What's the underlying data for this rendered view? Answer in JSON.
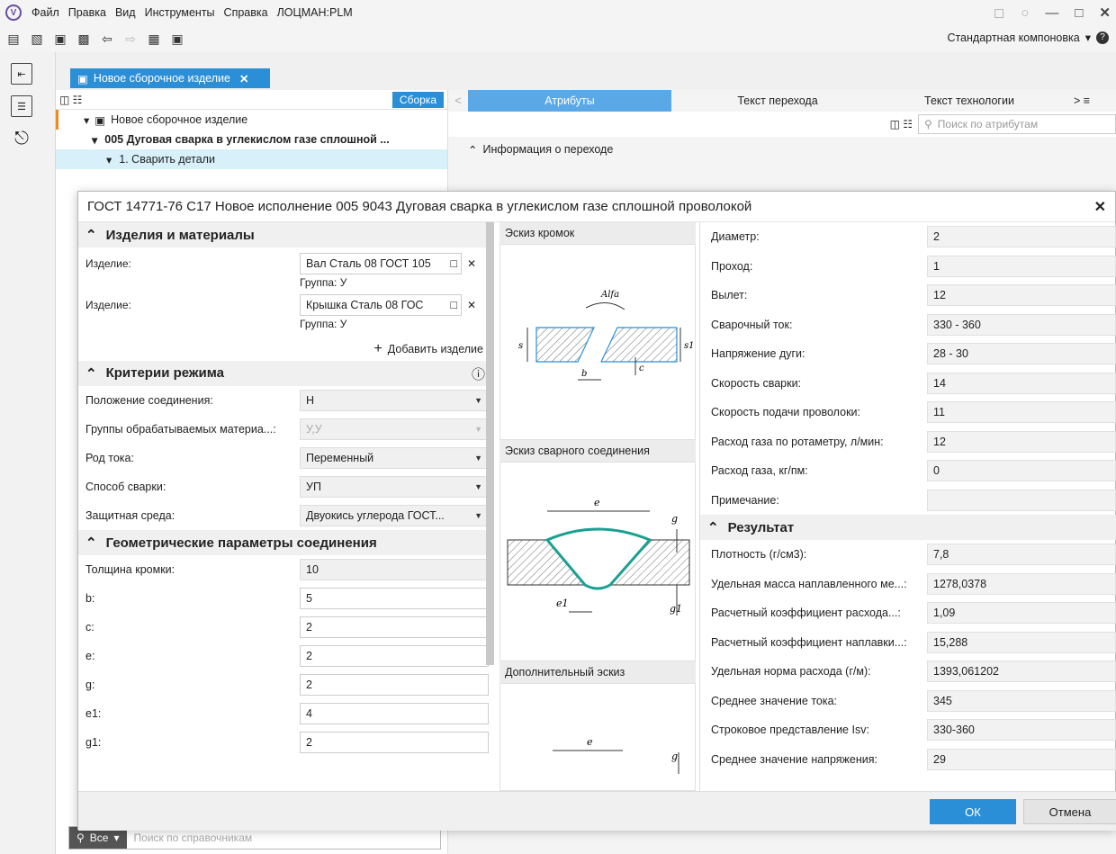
{
  "menu": [
    "Файл",
    "Правка",
    "Вид",
    "Инструменты",
    "Справка",
    "ЛОЦМАН:PLM"
  ],
  "layout_label": "Стандартная компоновка",
  "doc_tab": "Новое сборочное изделие",
  "tree": {
    "assembly_btn": "Сборка",
    "rows": [
      "Новое сборочное изделие",
      "005 Дуговая сварка в углекислом газе сплошной  ...",
      "1. Сварить детали"
    ]
  },
  "right": {
    "tabs": [
      "Атрибуты",
      "Текст перехода",
      "Текст технологии"
    ],
    "search_placeholder": "Поиск по атрибутам",
    "info": "Информация о переходе"
  },
  "search": {
    "all": "Все",
    "placeholder": "Поиск по справочникам"
  },
  "dialog": {
    "title": "ГОСТ 14771-76 С17 Новое исполнение 005  9043 Дуговая сварка в углекислом газе сплошной проволокой",
    "sec_items": "Изделия и материалы",
    "items": [
      {
        "label": "Изделие:",
        "value": "Вал Сталь 08 ГОСТ 105",
        "group": "Группа:  У"
      },
      {
        "label": "Изделие:",
        "value": "Крышка Сталь 08 ГОС",
        "group": "Группа:  У"
      }
    ],
    "add_item": "Добавить изделие",
    "sec_criteria": "Критерии режима",
    "criteria": [
      {
        "label": "Положение соединения:",
        "value": "Н"
      },
      {
        "label": "Группы обрабатываемых материа...:",
        "value": "У,У"
      },
      {
        "label": "Род тока:",
        "value": "Переменный"
      },
      {
        "label": "Способ сварки:",
        "value": "УП"
      },
      {
        "label": "Защитная среда:",
        "value": "Двуокись углерода ГОСТ..."
      }
    ],
    "sec_geom": "Геометрические параметры соединения",
    "geom": [
      {
        "label": "Толщина кромки:",
        "value": "10"
      },
      {
        "label": "b:",
        "value": "5"
      },
      {
        "label": "c:",
        "value": "2"
      },
      {
        "label": "e:",
        "value": "2"
      },
      {
        "label": "g:",
        "value": "2"
      },
      {
        "label": "e1:",
        "value": "4"
      },
      {
        "label": "g1:",
        "value": "2"
      }
    ],
    "sketch_edges": "Эскиз кромок",
    "sketch_weld": "Эскиз сварного соединения",
    "sketch_extra": "Дополнительный эскиз",
    "params": [
      {
        "label": "Диаметр:",
        "value": "2"
      },
      {
        "label": "Проход:",
        "value": "1"
      },
      {
        "label": "Вылет:",
        "value": "12"
      },
      {
        "label": "Сварочный ток:",
        "value": "330 - 360"
      },
      {
        "label": "Напряжение дуги:",
        "value": "28 - 30"
      },
      {
        "label": "Скорость сварки:",
        "value": "14"
      },
      {
        "label": "Скорость подачи проволоки:",
        "value": "11"
      },
      {
        "label": "Расход газа по ротаметру, л/мин:",
        "value": "12"
      },
      {
        "label": "Расход газа, кг/пм:",
        "value": "0"
      },
      {
        "label": "Примечание:",
        "value": ""
      }
    ],
    "sec_result": "Результат",
    "results": [
      {
        "label": "Плотность (г/см3):",
        "value": "7,8"
      },
      {
        "label": "Удельная масса наплавленного ме...:",
        "value": "1278,0378"
      },
      {
        "label": "Расчетный коэффициент расхода...:",
        "value": "1,09"
      },
      {
        "label": "Расчетный коэффициент наплавки...:",
        "value": "15,288"
      },
      {
        "label": "Удельная норма расхода (г/м):",
        "value": "1393,061202"
      },
      {
        "label": "Среднее значение тока:",
        "value": "345"
      },
      {
        "label": "Строковое представление Isv:",
        "value": "330-360"
      },
      {
        "label": "Среднее значение напряжения:",
        "value": "29"
      }
    ],
    "ok": "ОК",
    "cancel": "Отмена"
  }
}
